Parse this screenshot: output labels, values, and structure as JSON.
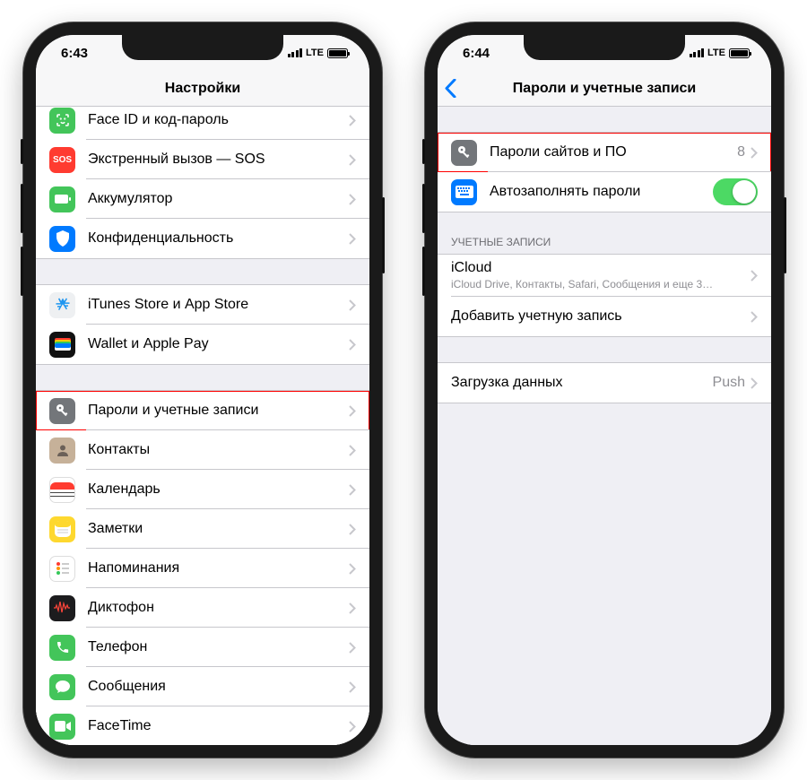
{
  "left": {
    "status": {
      "time": "6:43",
      "network": "LTE"
    },
    "nav": {
      "title": "Настройки"
    },
    "g1": [
      {
        "label": "Face ID и код-пароль",
        "icon": "faceid-icon"
      },
      {
        "label": "Экстренный вызов — SOS",
        "icon": "sos-icon"
      },
      {
        "label": "Аккумулятор",
        "icon": "battery-icon"
      },
      {
        "label": "Конфиденциальность",
        "icon": "privacy-icon"
      }
    ],
    "g2": [
      {
        "label": "iTunes Store и App Store",
        "icon": "appstore-icon"
      },
      {
        "label": "Wallet и Apple Pay",
        "icon": "wallet-icon"
      }
    ],
    "g3": [
      {
        "label": "Пароли и учетные записи",
        "icon": "passwords-icon",
        "highlight": true
      },
      {
        "label": "Контакты",
        "icon": "contacts-icon"
      },
      {
        "label": "Календарь",
        "icon": "calendar-icon"
      },
      {
        "label": "Заметки",
        "icon": "notes-icon"
      },
      {
        "label": "Напоминания",
        "icon": "reminders-icon"
      },
      {
        "label": "Диктофон",
        "icon": "voicerec-icon"
      },
      {
        "label": "Телефон",
        "icon": "phone-icon"
      },
      {
        "label": "Сообщения",
        "icon": "messages-icon"
      },
      {
        "label": "FaceTime",
        "icon": "facetime-icon"
      }
    ]
  },
  "right": {
    "status": {
      "time": "6:44",
      "network": "LTE"
    },
    "nav": {
      "title": "Пароли и учетные записи"
    },
    "r1": {
      "label": "Пароли сайтов и ПО",
      "count": "8",
      "highlight": true,
      "icon": "passwords-icon"
    },
    "r2": {
      "label": "Автозаполнять пароли",
      "icon": "keyboard-icon",
      "toggle": true
    },
    "accounts_header": "Учетные записи",
    "acc1": {
      "label": "iCloud",
      "sub": "iCloud Drive, Контакты, Safari, Сообщения и еще 3…"
    },
    "acc2": {
      "label": "Добавить учетную запись"
    },
    "fetch": {
      "label": "Загрузка данных",
      "value": "Push"
    }
  },
  "sos_text": "SOS"
}
